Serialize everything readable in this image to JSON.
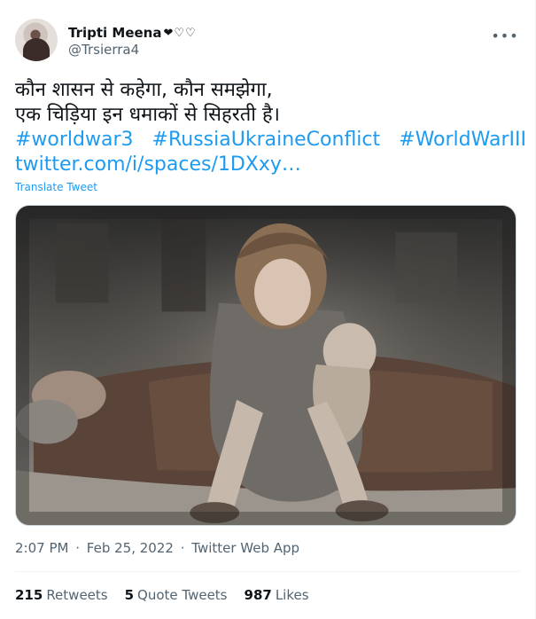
{
  "author": {
    "name": "Tripti Meena",
    "name_decor": "❤︎♡♡",
    "handle": "@Trsierra4"
  },
  "more_label": "•••",
  "tweet": {
    "lines": [
      "कौन शासन से कहेगा, कौन समझेगा,",
      "एक चिड़िया इन धमाकों से सिहरती है।"
    ],
    "hashtags": [
      "#worldwar3",
      "#RussiaUkraineConflict",
      "#WorldWarIII"
    ],
    "link": "twitter.com/i/spaces/1DXxy…",
    "translate_label": "Translate Tweet"
  },
  "meta": {
    "time": "2:07 PM",
    "date": "Feb 25, 2022",
    "source": "Twitter Web App",
    "sep": "·"
  },
  "stats": [
    {
      "count": "215",
      "label": "Retweets"
    },
    {
      "count": "5",
      "label": "Quote Tweets"
    },
    {
      "count": "987",
      "label": "Likes"
    }
  ]
}
